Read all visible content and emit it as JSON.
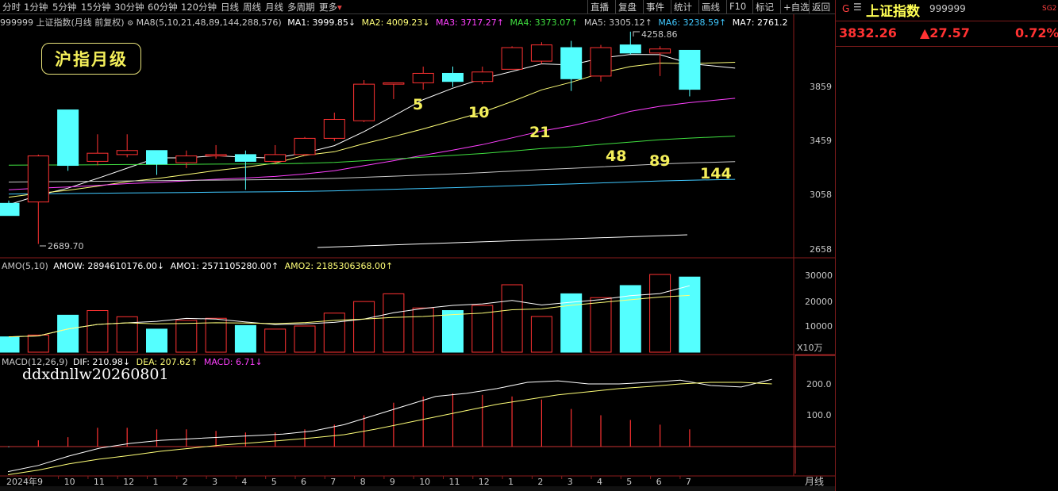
{
  "toolbar": {
    "periods": [
      "分时",
      "1分钟",
      "5分钟",
      "15分钟",
      "30分钟",
      "60分钟",
      "120分钟",
      "日线",
      "周线",
      "月线",
      "多周期",
      "更多"
    ],
    "more_label": "更多",
    "right_buttons": [
      "直播",
      "复盘",
      "事件",
      "统计",
      "画线",
      "F10",
      "标记",
      "+自选",
      "返回"
    ]
  },
  "stock": {
    "flag": "G",
    "name": "上证指数",
    "code": "999999",
    "tag": "SG2",
    "price": "3832.26",
    "change": "▲27.57",
    "change_pct": "0.72%"
  },
  "main_info": {
    "title": "999999 上证指数(月线 前复权)",
    "ma_group": "MA8(5,10,21,48,89,144,288,576)",
    "ma1": "MA1: 3999.85↓",
    "ma2": "MA2: 4009.23↓",
    "ma3": "MA3: 3717.27↑",
    "ma4": "MA4: 3373.07↑",
    "ma5": "MA5: 3305.12↑",
    "ma6": "MA6: 3238.59↑",
    "ma7": "MA7: 2761.2"
  },
  "logo_text": "沪指月级",
  "watermark": "ddxdnllw20260801",
  "annotations": {
    "high": "4258.86",
    "low": "2689.70",
    "ma_labels": [
      "5",
      "10",
      "21",
      "48",
      "89",
      "144"
    ]
  },
  "price_axis": [
    "3859",
    "3459",
    "3058",
    "2658"
  ],
  "amo_info": {
    "title": "AMO(5,10)",
    "amow": "AMOW: 2894610176.00↓",
    "amo1": "AMO1: 2571105280.00↑",
    "amo2": "AMO2: 2185306368.00↑"
  },
  "amo_axis": [
    "30000",
    "20000",
    "10000"
  ],
  "amo_unit": "X10万",
  "macd_info": {
    "title": "MACD(12,26,9)",
    "dif": "DIF: 210.98↓",
    "dea": "DEA: 207.62↑",
    "macd": "MACD: 6.71↓"
  },
  "macd_axis": [
    "200.0",
    "100.0"
  ],
  "x_axis": [
    "2024年9",
    "10",
    "11",
    "12",
    "1",
    "2",
    "3",
    "4",
    "5",
    "6",
    "7",
    "8",
    "9",
    "10",
    "11",
    "12",
    "1",
    "2",
    "3",
    "4",
    "5",
    "6",
    "7"
  ],
  "period_label": "月线",
  "colors": {
    "up": "#ff3232",
    "down": "#54ffff",
    "ma1": "#ffffff",
    "ma2": "#ffff78",
    "ma3": "#ff40ff",
    "ma4": "#40e040",
    "ma5": "#c8c8c8",
    "ma6": "#40c8ff",
    "ma7": "#ffffff"
  },
  "candles": [
    {
      "o": 2990,
      "h": 3010,
      "l": 2910,
      "c": 2900
    },
    {
      "o": 3000,
      "h": 3350,
      "l": 2690,
      "c": 3340
    },
    {
      "o": 3680,
      "h": 3680,
      "l": 3230,
      "c": 3270
    },
    {
      "o": 3300,
      "h": 3500,
      "l": 3270,
      "c": 3360
    },
    {
      "o": 3350,
      "h": 3500,
      "l": 3330,
      "c": 3380
    },
    {
      "o": 3380,
      "h": 3380,
      "l": 3200,
      "c": 3280
    },
    {
      "o": 3290,
      "h": 3380,
      "l": 3250,
      "c": 3340
    },
    {
      "o": 3340,
      "h": 3420,
      "l": 3320,
      "c": 3350
    },
    {
      "o": 3350,
      "h": 3380,
      "l": 3090,
      "c": 3300
    },
    {
      "o": 3300,
      "h": 3420,
      "l": 3280,
      "c": 3350
    },
    {
      "o": 3350,
      "h": 3480,
      "l": 3340,
      "c": 3470
    },
    {
      "o": 3470,
      "h": 3660,
      "l": 3450,
      "c": 3610
    },
    {
      "o": 3600,
      "h": 3900,
      "l": 3590,
      "c": 3870
    },
    {
      "o": 3870,
      "h": 3880,
      "l": 3760,
      "c": 3880
    },
    {
      "o": 3880,
      "h": 4000,
      "l": 3830,
      "c": 3950
    },
    {
      "o": 3950,
      "h": 4000,
      "l": 3850,
      "c": 3890
    },
    {
      "o": 3890,
      "h": 4000,
      "l": 3870,
      "c": 3960
    },
    {
      "o": 3980,
      "h": 4150,
      "l": 3980,
      "c": 4140
    },
    {
      "o": 4040,
      "h": 4180,
      "l": 4020,
      "c": 4160
    },
    {
      "o": 4140,
      "h": 4190,
      "l": 3820,
      "c": 3910
    },
    {
      "o": 3930,
      "h": 4160,
      "l": 3890,
      "c": 4140
    },
    {
      "o": 4160,
      "h": 4258,
      "l": 4090,
      "c": 4100
    },
    {
      "o": 4100,
      "h": 4150,
      "l": 3930,
      "c": 4130
    },
    {
      "o": 4120,
      "h": 4120,
      "l": 3780,
      "c": 3832
    }
  ],
  "amo": [
    5800,
    6500,
    14200,
    16000,
    13600,
    8800,
    12200,
    13000,
    10200,
    8800,
    10000,
    15000,
    19500,
    22500,
    17000,
    16000,
    18000,
    26000,
    13700,
    22500,
    21000,
    25700,
    30000,
    29000
  ],
  "macd_bars": [
    -2,
    20,
    30,
    60,
    60,
    55,
    55,
    50,
    45,
    45,
    55,
    70,
    100,
    140,
    160,
    170,
    165,
    160,
    150,
    120,
    100,
    85,
    70,
    55
  ]
}
